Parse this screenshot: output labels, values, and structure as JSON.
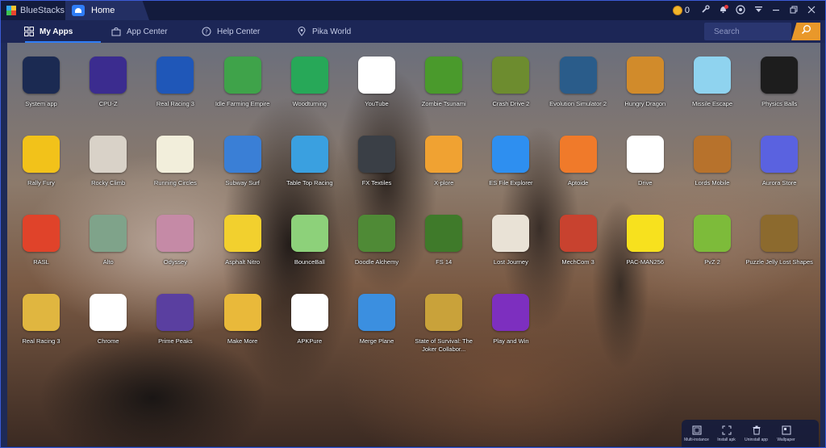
{
  "titlebar": {
    "brand": "BlueStacks",
    "home_tab": "Home",
    "coins": "0"
  },
  "nav": {
    "tabs": [
      {
        "label": "My Apps",
        "icon": "grid-icon"
      },
      {
        "label": "App Center",
        "icon": "bag-icon"
      },
      {
        "label": "Help Center",
        "icon": "question-icon"
      },
      {
        "label": "Pika World",
        "icon": "pin-icon"
      }
    ],
    "search_placeholder": "Search"
  },
  "apps": [
    {
      "label": "System app",
      "icon": "system-app-icon",
      "color": "#1b2a52"
    },
    {
      "label": "CPU-Z",
      "icon": "cpu-z-icon",
      "color": "#3b2c8f"
    },
    {
      "label": "Real Racing 3",
      "icon": "real-racing-3-icon",
      "color": "#1f57b8"
    },
    {
      "label": "Idle Farming Empire",
      "icon": "idle-farming-empire-icon",
      "color": "#3fa34a"
    },
    {
      "label": "Woodturning",
      "icon": "woodturning-icon",
      "color": "#27a858"
    },
    {
      "label": "YouTube",
      "icon": "youtube-icon",
      "color": "#ffffff"
    },
    {
      "label": "Zombie Tsunami",
      "icon": "zombie-tsunami-icon",
      "color": "#4a9a2c"
    },
    {
      "label": "Crash Drive 2",
      "icon": "crash-drive-2-icon",
      "color": "#6d8c2f"
    },
    {
      "label": "Evolution Simulator 2",
      "icon": "evolution-simulator-2-icon",
      "color": "#2a5c8a"
    },
    {
      "label": "Hungry Dragon",
      "icon": "hungry-dragon-icon",
      "color": "#d18b2b"
    },
    {
      "label": "Missile Escape",
      "icon": "missile-escape-icon",
      "color": "#8fd3ef"
    },
    {
      "label": "Physics Balls",
      "icon": "physics-balls-icon",
      "color": "#1d1d1d"
    },
    {
      "label": "Rally Fury",
      "icon": "rally-fury-icon",
      "color": "#f2c21a"
    },
    {
      "label": "Rocky Climb",
      "icon": "rocky-climb-icon",
      "color": "#d9d2c8"
    },
    {
      "label": "Running Circles",
      "icon": "running-circles-icon",
      "color": "#f2eedb"
    },
    {
      "label": "Subway Surf",
      "icon": "subway-surf-icon",
      "color": "#3a7fd6"
    },
    {
      "label": "Table Top Racing",
      "icon": "table-top-racing-icon",
      "color": "#3aa0e0"
    },
    {
      "label": "FX Textiles",
      "icon": "fx-textiles-icon",
      "color": "#3a3f46"
    },
    {
      "label": "X-plore",
      "icon": "x-plore-icon",
      "color": "#f0a232"
    },
    {
      "label": "ES File Explorer",
      "icon": "es-file-explorer-icon",
      "color": "#2e8ff0"
    },
    {
      "label": "Aptoide",
      "icon": "aptoide-icon",
      "color": "#f07a2a"
    },
    {
      "label": "Drive",
      "icon": "drive-icon",
      "color": "#ffffff"
    },
    {
      "label": "Lords Mobile",
      "icon": "lords-mobile-icon",
      "color": "#b7722c"
    },
    {
      "label": "Aurora Store",
      "icon": "aurora-store-icon",
      "color": "#5a62e0"
    },
    {
      "label": "RASL",
      "icon": "rasl-icon",
      "color": "#e0432a"
    },
    {
      "label": "Alto",
      "icon": "alto-icon",
      "color": "#7fa38a"
    },
    {
      "label": "Odyssey",
      "icon": "odyssey-icon",
      "color": "#c58aa6"
    },
    {
      "label": "Asphalt Nitro",
      "icon": "asphalt-nitro-icon",
      "color": "#f2d02e"
    },
    {
      "label": "BounceBall",
      "icon": "bounceball-icon",
      "color": "#8dd17a"
    },
    {
      "label": "Doodle Alchemy",
      "icon": "doodle-alchemy-icon",
      "color": "#4f8a36"
    },
    {
      "label": "FS 14",
      "icon": "fs-14-icon",
      "color": "#3f7a2a"
    },
    {
      "label": "Lost Journey",
      "icon": "lost-journey-icon",
      "color": "#e9e2d6"
    },
    {
      "label": "MechCom 3",
      "icon": "mechcom-3-icon",
      "color": "#c8422f"
    },
    {
      "label": "PAC-MAN256",
      "icon": "pac-man256-icon",
      "color": "#f7e11e"
    },
    {
      "label": "PvZ 2",
      "icon": "pvz-2-icon",
      "color": "#7dbb3a"
    },
    {
      "label": "Puzzle Jelly Lost Shapes",
      "icon": "puzzle-jelly-lost-shapes-icon",
      "color": "#8c6a2e"
    },
    {
      "label": "Real Racing 3",
      "icon": "real-racing-3-alt-icon",
      "color": "#e0b640"
    },
    {
      "label": "Chrome",
      "icon": "chrome-icon",
      "color": "#ffffff"
    },
    {
      "label": "Prime Peaks",
      "icon": "prime-peaks-icon",
      "color": "#5a3fa0"
    },
    {
      "label": "Make More",
      "icon": "make-more-icon",
      "color": "#e9b93a"
    },
    {
      "label": "APKPure",
      "icon": "apkpure-icon",
      "color": "#ffffff"
    },
    {
      "label": "Merge Plane",
      "icon": "merge-plane-icon",
      "color": "#3b8fe0"
    },
    {
      "label": "State of Survival: The Joker Collabor...",
      "icon": "state-of-survival-icon",
      "color": "#c9a23a"
    },
    {
      "label": "Play and Win",
      "icon": "play-and-win-icon",
      "color": "#7d2fbf"
    }
  ],
  "bottom_bar": {
    "items": [
      {
        "label": "Multi-instance",
        "icon": "multi-instance-icon"
      },
      {
        "label": "Install apk",
        "icon": "install-apk-icon"
      },
      {
        "label": "Uninstall app",
        "icon": "trash-icon"
      },
      {
        "label": "Wallpaper",
        "icon": "wallpaper-icon"
      }
    ]
  }
}
